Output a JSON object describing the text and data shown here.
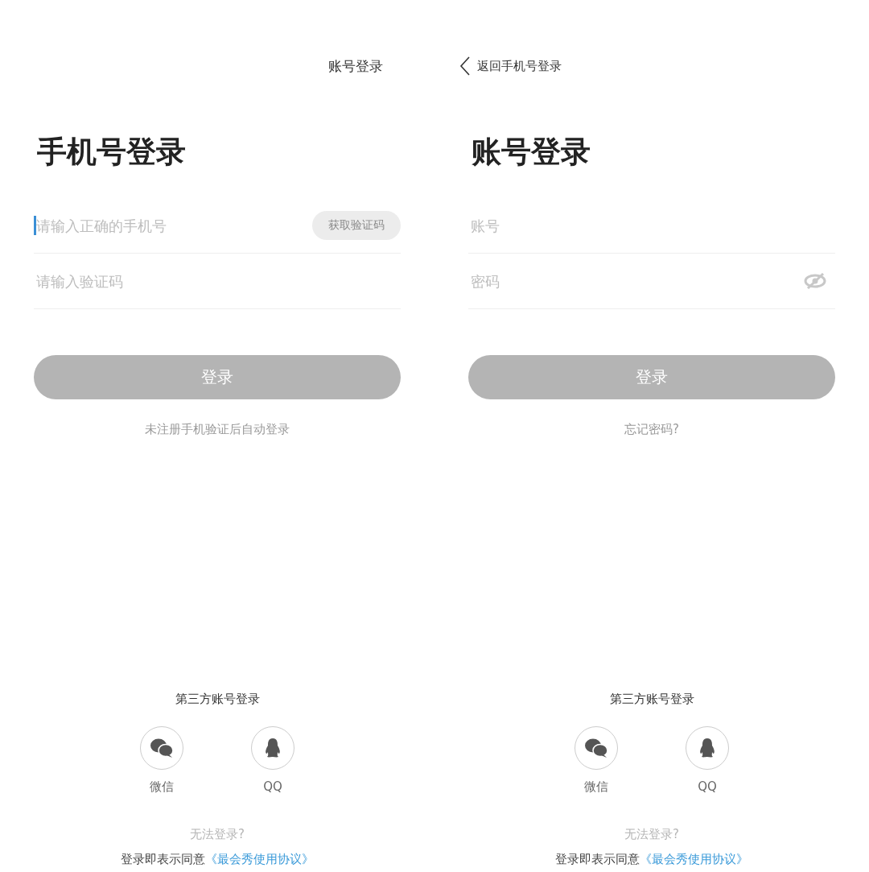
{
  "panels": [
    {
      "header": {
        "kind": "link",
        "label": "账号登录"
      },
      "title": "手机号登录",
      "fields": [
        {
          "placeholder": "请输入正确的手机号",
          "focused": true,
          "kind": "code",
          "action": {
            "label": "获取验证码",
            "disabled": true
          }
        },
        {
          "placeholder": "请输入验证码",
          "focused": false,
          "kind": "text"
        }
      ],
      "submit": {
        "label": "登录",
        "disabled": true
      },
      "hint": "未注册手机验证后自动登录",
      "third_party": {
        "title": "第三方账号登录",
        "options": [
          {
            "label": "微信",
            "kind": "wechat"
          },
          {
            "label": "QQ",
            "kind": "qq"
          }
        ]
      },
      "help": "无法登录?",
      "agreement": {
        "text": "登录即表示同意",
        "link": "《最会秀使用协议》"
      }
    },
    {
      "header": {
        "kind": "back",
        "label": "返回手机号登录"
      },
      "title": "账号登录",
      "fields": [
        {
          "placeholder": "账号",
          "focused": false,
          "kind": "text"
        },
        {
          "placeholder": "密码",
          "focused": false,
          "kind": "password"
        }
      ],
      "submit": {
        "label": "登录",
        "disabled": true
      },
      "hint": "忘记密码?",
      "third_party": {
        "title": "第三方账号登录",
        "options": [
          {
            "label": "微信",
            "kind": "wechat"
          },
          {
            "label": "QQ",
            "kind": "qq"
          }
        ]
      },
      "help": "无法登录?",
      "agreement": {
        "text": "登录即表示同意",
        "link": "《最会秀使用协议》"
      }
    }
  ]
}
